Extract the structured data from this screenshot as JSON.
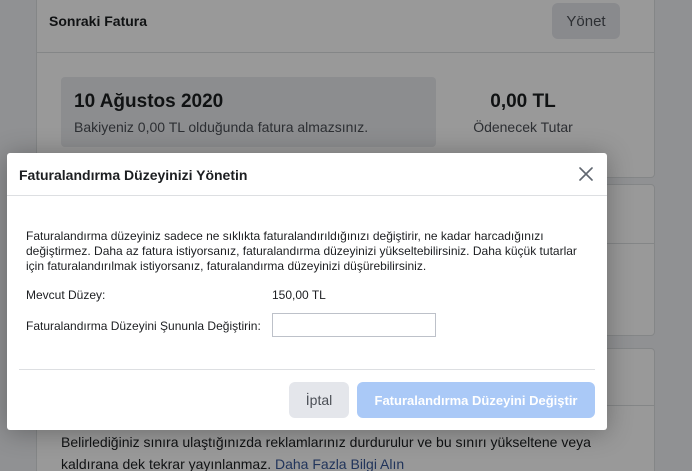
{
  "background": {
    "billing_card": {
      "title": "Sonraki Fatura",
      "manage_label": "Yönet",
      "date": "10 Ağustos 2020",
      "date_note": "Bakiyeniz 0,00 TL olduğunda fatura almazsınız.",
      "amount": "0,00 TL",
      "amount_label": "Ödenecek Tutar"
    },
    "limit_card": {
      "text": "Belirlediğiniz sınıra ulaştığınızda reklamlarınız durdurulur ve bu sınırı yükseltene veya kaldırana dek tekrar yayınlanmaz.",
      "link": "Daha Fazla Bilgi Alın"
    }
  },
  "modal": {
    "title": "Faturalandırma Düzeyinizi Yönetin",
    "description": "Faturalandırma düzeyiniz sadece ne sıklıkta faturalandırıldığınızı değiştirir, ne kadar harcadığınızı değiştirmez. Daha az fatura istiyorsanız, faturalandırma düzeyinizi yükseltebilirsiniz. Daha küçük tutarlar için faturalandırılmak istiyorsanız, faturalandırma düzeyinizi düşürebilirsiniz.",
    "current_label": "Mevcut Düzey:",
    "current_value": "150,00 TL",
    "change_label": "Faturalandırma Düzeyini Şununla Değiştirin:",
    "change_value": "",
    "change_placeholder": "",
    "cancel_label": "İptal",
    "submit_label": "Faturalandırma Düzeyini Değiştir",
    "close_icon": "close-icon"
  },
  "colors": {
    "submit_disabled": "#aac9f7",
    "link": "#385898",
    "overlay": "rgba(0,0,0,0.4)"
  }
}
